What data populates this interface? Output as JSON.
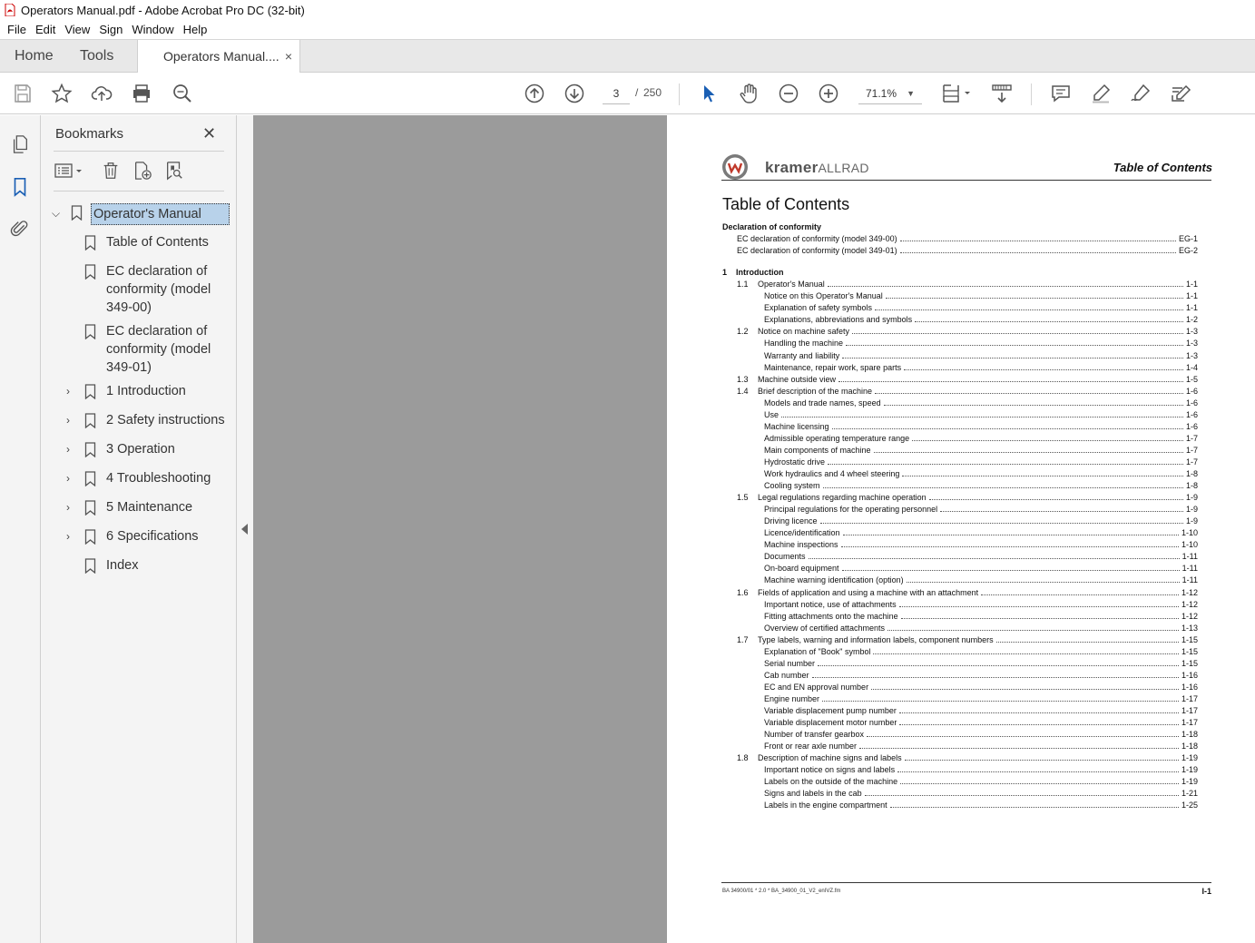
{
  "window": {
    "title": "Operators Manual.pdf - Adobe Acrobat Pro DC (32-bit)"
  },
  "menu": [
    "File",
    "Edit",
    "View",
    "Sign",
    "Window",
    "Help"
  ],
  "tabs": {
    "home": "Home",
    "tools": "Tools",
    "document": "Operators Manual....",
    "close": "×"
  },
  "toolbar": {
    "page_current": "3",
    "page_sep": "/",
    "page_total": "250",
    "zoom": "71.1%"
  },
  "bookmarks": {
    "title": "Bookmarks",
    "close": "✕",
    "items": [
      {
        "label": "Operator's Manual"
      },
      {
        "label": "Table of Contents"
      },
      {
        "label": "EC declaration of conformity (model 349-00)"
      },
      {
        "label": "EC declaration of conformity (model 349-01)"
      },
      {
        "label": "1 Introduction"
      },
      {
        "label": "2 Safety instructions"
      },
      {
        "label": "3 Operation"
      },
      {
        "label": "4 Troubleshooting"
      },
      {
        "label": "5 Maintenance"
      },
      {
        "label": "6 Specifications"
      },
      {
        "label": "Index"
      }
    ]
  },
  "page": {
    "brand_bold": "kramer",
    "brand_rest": "ALLRAD",
    "header_title": "Table of Contents",
    "heading": "Table of Contents",
    "toc": [
      {
        "num": "",
        "text": "Declaration of conformity",
        "page": "",
        "level": 0
      },
      {
        "num": "",
        "text": "EC declaration of conformity (model 349-00)",
        "page": "EG-1",
        "level": 1
      },
      {
        "num": "",
        "text": "EC declaration of conformity (model 349-01)",
        "page": "EG-2",
        "level": 1
      },
      {
        "num": "1",
        "text": "Introduction",
        "page": "",
        "level": 0
      },
      {
        "num": "1.1",
        "text": "Operator's Manual",
        "page": "1-1",
        "level": 2
      },
      {
        "num": "",
        "text": "Notice on this Operator's Manual",
        "page": "1-1",
        "level": 3
      },
      {
        "num": "",
        "text": "Explanation of safety symbols",
        "page": "1-1",
        "level": 3
      },
      {
        "num": "",
        "text": "Explanations, abbreviations and symbols",
        "page": "1-2",
        "level": 3
      },
      {
        "num": "1.2",
        "text": "Notice on machine safety",
        "page": "1-3",
        "level": 2
      },
      {
        "num": "",
        "text": "Handling the machine",
        "page": "1-3",
        "level": 3
      },
      {
        "num": "",
        "text": "Warranty and liability",
        "page": "1-3",
        "level": 3
      },
      {
        "num": "",
        "text": "Maintenance, repair work, spare parts",
        "page": "1-4",
        "level": 3
      },
      {
        "num": "1.3",
        "text": "Machine outside view",
        "page": "1-5",
        "level": 2
      },
      {
        "num": "1.4",
        "text": "Brief description of the machine",
        "page": "1-6",
        "level": 2
      },
      {
        "num": "",
        "text": "Models and trade names, speed",
        "page": "1-6",
        "level": 3
      },
      {
        "num": "",
        "text": "Use",
        "page": "1-6",
        "level": 3
      },
      {
        "num": "",
        "text": "Machine licensing",
        "page": "1-6",
        "level": 3
      },
      {
        "num": "",
        "text": "Admissible operating temperature range",
        "page": "1-7",
        "level": 3
      },
      {
        "num": "",
        "text": "Main components of machine",
        "page": "1-7",
        "level": 3
      },
      {
        "num": "",
        "text": "Hydrostatic drive",
        "page": "1-7",
        "level": 3
      },
      {
        "num": "",
        "text": "Work hydraulics and 4 wheel steering",
        "page": "1-8",
        "level": 3
      },
      {
        "num": "",
        "text": "Cooling system",
        "page": "1-8",
        "level": 3
      },
      {
        "num": "1.5",
        "text": "Legal regulations regarding machine operation",
        "page": "1-9",
        "level": 2
      },
      {
        "num": "",
        "text": "Principal regulations for the operating personnel",
        "page": "1-9",
        "level": 3
      },
      {
        "num": "",
        "text": "Driving licence",
        "page": "1-9",
        "level": 3
      },
      {
        "num": "",
        "text": "Licence/identification",
        "page": "1-10",
        "level": 3
      },
      {
        "num": "",
        "text": "Machine inspections",
        "page": "1-10",
        "level": 3
      },
      {
        "num": "",
        "text": "Documents",
        "page": "1-11",
        "level": 3
      },
      {
        "num": "",
        "text": "On-board equipment",
        "page": "1-11",
        "level": 3
      },
      {
        "num": "",
        "text": "Machine warning identification (option)",
        "page": "1-11",
        "level": 3
      },
      {
        "num": "1.6",
        "text": "Fields of application and using a machine with an attachment",
        "page": "1-12",
        "level": 2
      },
      {
        "num": "",
        "text": "Important notice, use of attachments",
        "page": "1-12",
        "level": 3
      },
      {
        "num": "",
        "text": "Fitting attachments onto the machine",
        "page": "1-12",
        "level": 3
      },
      {
        "num": "",
        "text": "Overview of certified attachments",
        "page": "1-13",
        "level": 3
      },
      {
        "num": "1.7",
        "text": "Type labels, warning and information labels, component numbers",
        "page": "1-15",
        "level": 2
      },
      {
        "num": "",
        "text": "Explanation of \"Book\" symbol",
        "page": "1-15",
        "level": 3
      },
      {
        "num": "",
        "text": "Serial number",
        "page": "1-15",
        "level": 3
      },
      {
        "num": "",
        "text": "Cab number",
        "page": "1-16",
        "level": 3
      },
      {
        "num": "",
        "text": "EC and EN approval number",
        "page": "1-16",
        "level": 3
      },
      {
        "num": "",
        "text": "Engine number",
        "page": "1-17",
        "level": 3
      },
      {
        "num": "",
        "text": "Variable displacement pump number",
        "page": "1-17",
        "level": 3
      },
      {
        "num": "",
        "text": "Variable displacement motor number",
        "page": "1-17",
        "level": 3
      },
      {
        "num": "",
        "text": "Number of transfer gearbox",
        "page": "1-18",
        "level": 3
      },
      {
        "num": "",
        "text": "Front or rear axle number",
        "page": "1-18",
        "level": 3
      },
      {
        "num": "1.8",
        "text": "Description of machine signs and labels",
        "page": "1-19",
        "level": 2
      },
      {
        "num": "",
        "text": "Important notice on signs and labels",
        "page": "1-19",
        "level": 3
      },
      {
        "num": "",
        "text": "Labels on the outside of the machine",
        "page": "1-19",
        "level": 3
      },
      {
        "num": "",
        "text": "Signs and labels in the cab",
        "page": "1-21",
        "level": 3
      },
      {
        "num": "",
        "text": "Labels in the engine compartment",
        "page": "1-25",
        "level": 3
      }
    ],
    "footer_left": "BA 34900/01 * 2.0 * BA_34900_01_V2_enIVZ.fm",
    "footer_right": "I-1"
  }
}
